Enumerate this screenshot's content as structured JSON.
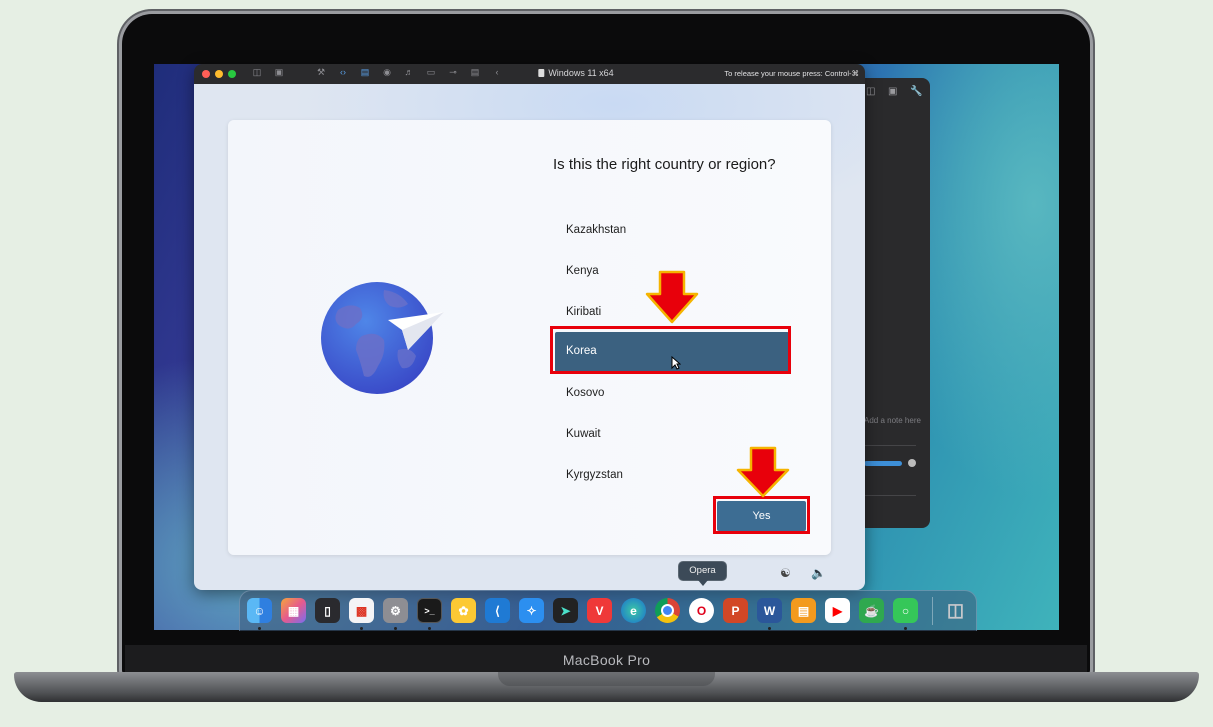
{
  "device": {
    "label": "MacBook Pro"
  },
  "background_app": {
    "note_placeholder": "Add a note here"
  },
  "vm_window": {
    "title": "Windows 11 x64",
    "release_hint": "To release your mouse press: Control-⌘",
    "toolbar_icons": [
      "sidebar-icon",
      "snapshot-icon",
      "wrench-icon",
      "code-icon",
      "drive-icon",
      "camera-icon",
      "sound-icon",
      "video-icon",
      "usb-icon",
      "share-icon",
      "back-icon"
    ]
  },
  "oobe": {
    "question": "Is this the right country or region?",
    "countries": [
      "Kazakhstan",
      "Kenya",
      "Kiribati",
      "Korea",
      "Kosovo",
      "Kuwait",
      "Kyrgyzstan"
    ],
    "selected_country": "Korea",
    "yes_label": "Yes",
    "accessibility_icon": "accessibility-icon",
    "volume_icon": "volume-icon"
  },
  "dock": {
    "tooltip": "Opera",
    "apps": [
      "Finder",
      "Launchpad",
      "iPhone Mirroring",
      "Parallels",
      "System Settings",
      "Terminal",
      "Tips",
      "Visual Studio Code",
      "Safari",
      "Swift",
      "Vivaldi",
      "Microsoft Edge",
      "Google Chrome",
      "Opera",
      "PowerPoint",
      "Word",
      "Books",
      "YouTube",
      "Coffee",
      "Messages",
      "Trash"
    ]
  },
  "colors": {
    "selection": "#3b6180",
    "yes_button": "#3d6d93",
    "highlight_box": "#e8000b",
    "arrow": "#e8000b",
    "arrow_outline": "#f5b400"
  }
}
